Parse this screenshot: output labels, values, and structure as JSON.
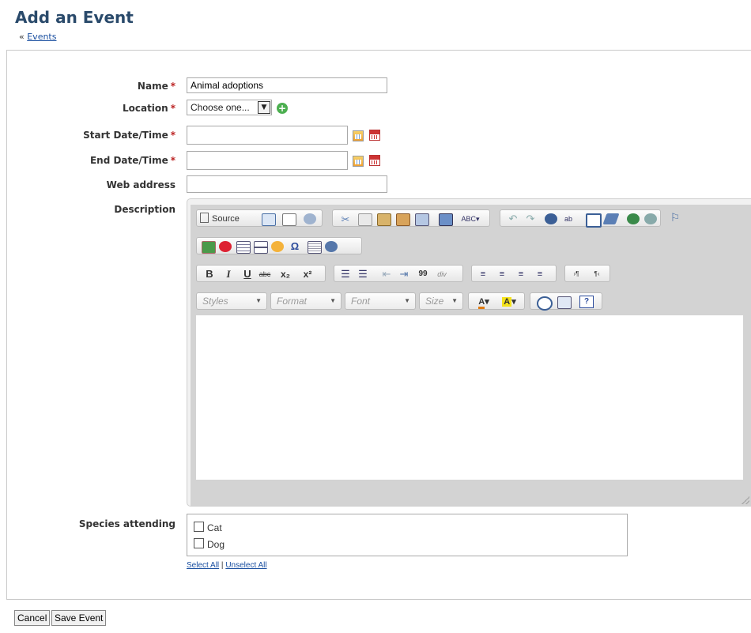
{
  "header": {
    "title": "Add an Event",
    "breadcrumb_prefix": "«",
    "breadcrumb_link": "Events"
  },
  "form": {
    "name_label": "Name",
    "name_value": "Animal adoptions",
    "location_label": "Location",
    "location_value": "Choose one...",
    "start_label": "Start Date/Time",
    "end_label": "End Date/Time",
    "web_label": "Web address",
    "desc_label": "Description",
    "species_label": "Species attending",
    "required_mark": "*"
  },
  "editor": {
    "source_label": "Source",
    "bold": "B",
    "italic": "I",
    "underline": "U",
    "strike": "abc",
    "subscript": "x₂",
    "superscript": "x²",
    "blockquote": "99",
    "div": "div",
    "omega": "Ω",
    "ltr": "›¶",
    "rtl": "¶‹",
    "help": "?",
    "combos": {
      "styles": "Styles",
      "format": "Format",
      "font": "Font",
      "size": "Size"
    }
  },
  "species": [
    {
      "label": "Cat",
      "checked": false
    },
    {
      "label": "Dog",
      "checked": false
    }
  ],
  "selection": {
    "select_all": "Select All",
    "separator": "|",
    "unselect_all": "Unselect All"
  },
  "buttons": {
    "cancel": "Cancel",
    "save": "Save Event"
  },
  "colors": {
    "title": "#2a4a6b",
    "link": "#1a4fa0",
    "required": "#bb2222"
  }
}
